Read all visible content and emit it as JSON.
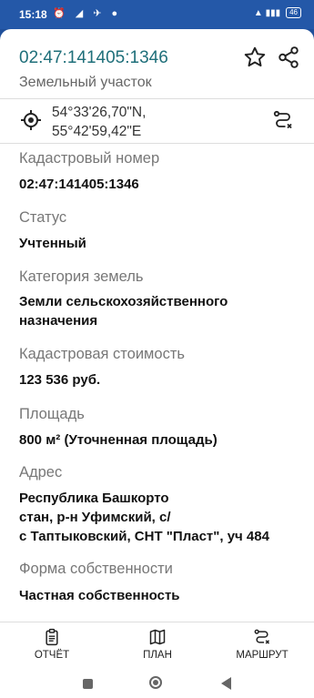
{
  "statusbar": {
    "time": "15:18",
    "left_icons": "⏰ ◢ ✈ ●",
    "signal": "▲ ▮▮▮",
    "battery": "46"
  },
  "header": {
    "title": "02:47:141405:1346",
    "subtitle": "Земельный участок"
  },
  "coordinates": {
    "lat": "54°33'26,70\"N,",
    "lon": "55°42'59,42\"E"
  },
  "fields": [
    {
      "label": "Кадастровый номер",
      "value_lines": [
        "02:47:141405:1346"
      ]
    },
    {
      "label": "Статус",
      "value_lines": [
        "Учтенный"
      ]
    },
    {
      "label": "Категория земель",
      "value_lines": [
        "Земли сельскохозяйственного",
        "назначения"
      ]
    },
    {
      "label": "Кадастровая стоимость",
      "value_lines": [
        "123 536 руб."
      ]
    },
    {
      "label": "Площадь",
      "value_lines": [
        "800 м² (Уточненная площадь)"
      ]
    },
    {
      "label": "Адрес",
      "value_lines": [
        "Республика Башкорто",
        "стан, р-н Уфимский, с/",
        "с Таптыковский,  СНТ \"Пласт\", уч 484"
      ]
    },
    {
      "label": "Форма собственности",
      "value_lines": [
        "Частная собственность"
      ]
    }
  ],
  "bottom_nav": {
    "report": "ОТЧЁТ",
    "plan": "ПЛАН",
    "route": "МАРШРУТ"
  },
  "icons": [
    "star-icon",
    "share-icon",
    "target-icon",
    "route-icon",
    "report-icon",
    "map-icon",
    "route-icon"
  ],
  "colors": {
    "title": "#1f6f7a",
    "statusbar": "#2458a8"
  }
}
